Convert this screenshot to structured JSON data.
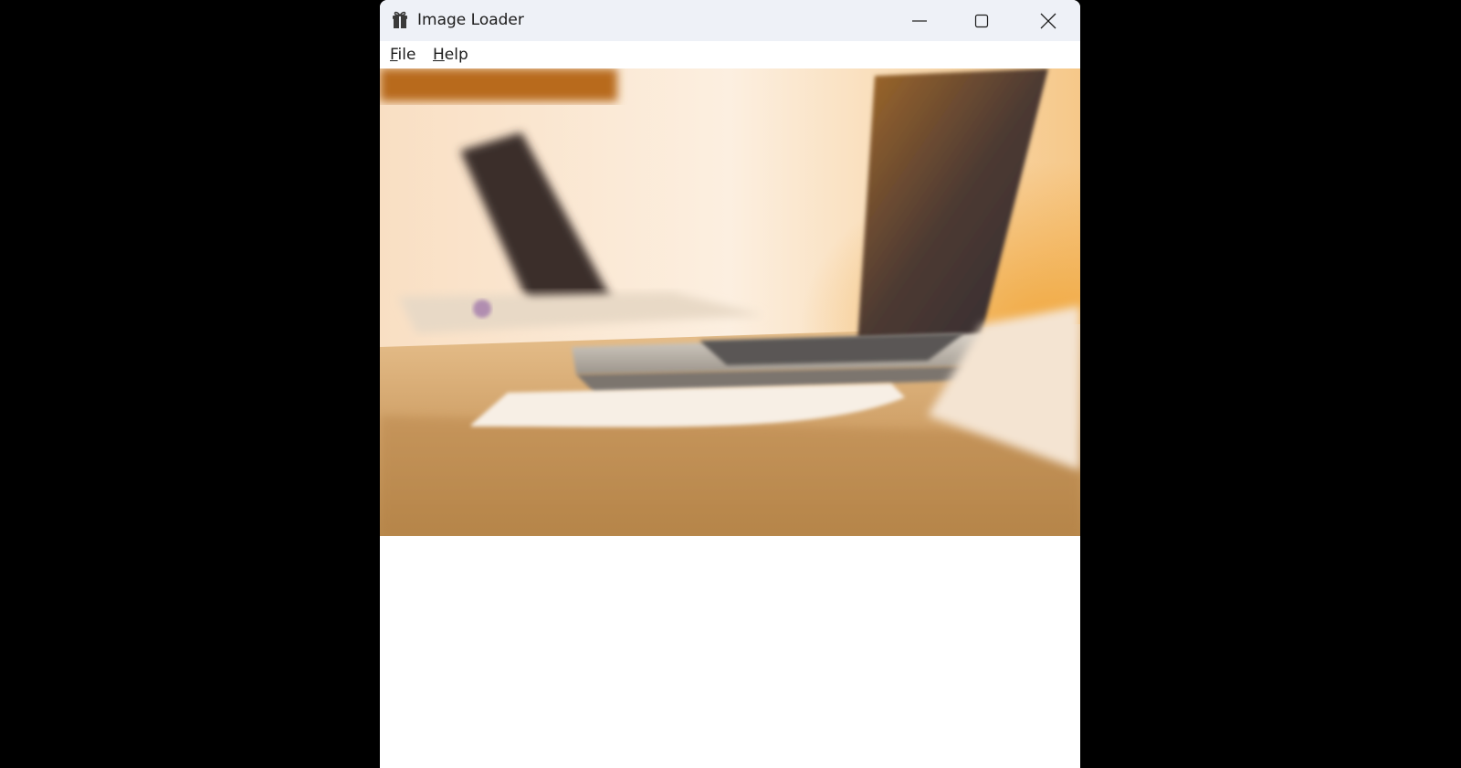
{
  "window": {
    "title": "Image Loader",
    "app_icon": "gift-icon",
    "controls": {
      "minimize_icon": "minimize-icon",
      "maximize_icon": "maximize-icon",
      "close_icon": "close-icon"
    }
  },
  "menubar": {
    "items": [
      {
        "label_accel": "F",
        "label_rest": "ile"
      },
      {
        "label_accel": "H",
        "label_rest": "elp"
      }
    ]
  },
  "image": {
    "subject": "laptops on wooden desk, warm blurred photo",
    "colors": {
      "wall": "#fbe8cf",
      "desk": "#c9985c",
      "glow": "#f0a63a"
    }
  },
  "colors": {
    "desktop": "#000000",
    "titlebar": "#eef1f7",
    "window": "#ffffff",
    "text": "#1b1b1b"
  }
}
